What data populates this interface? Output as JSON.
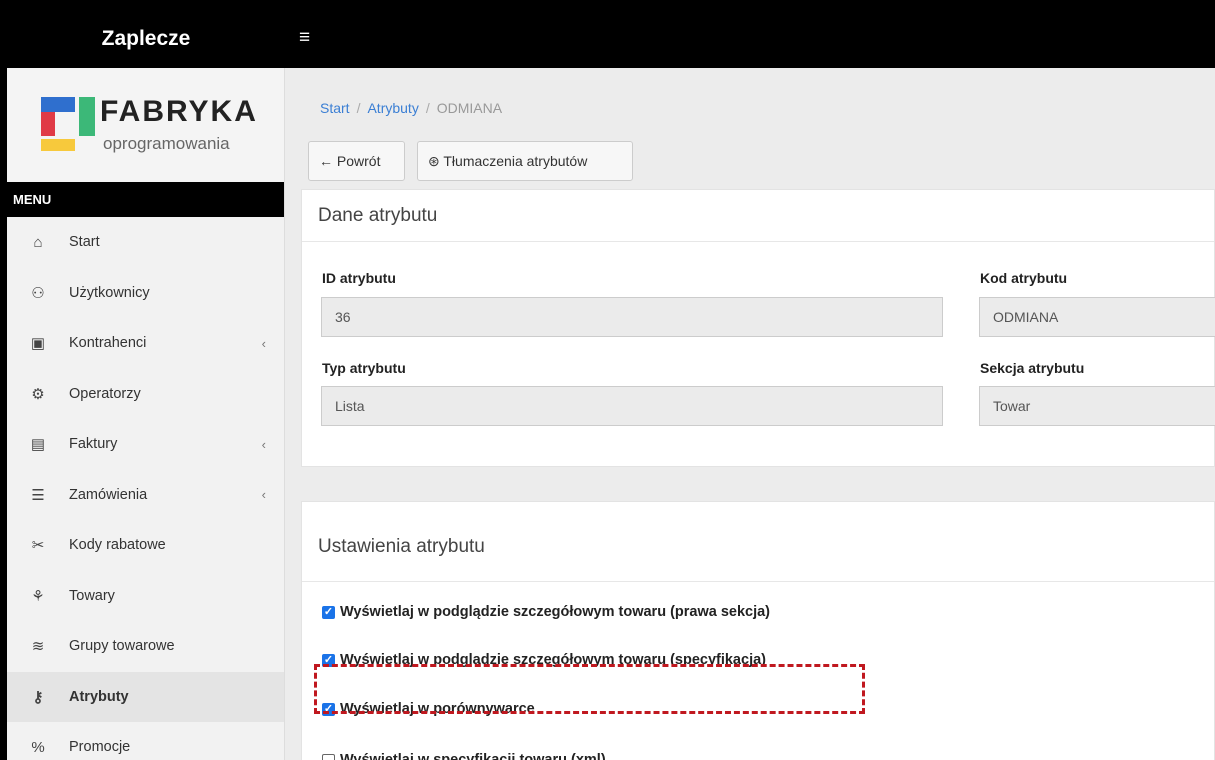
{
  "topbar": {
    "brand": "Zaplecze",
    "menu_toggle": "≡"
  },
  "logo": {
    "title": "FABRYKA",
    "subtitle": "oprogramowania"
  },
  "sidebar": {
    "heading": "MENU",
    "items": [
      {
        "label": "Start",
        "icon": "⌂",
        "chevron": ""
      },
      {
        "label": "Użytkownicy",
        "icon": "⚇",
        "chevron": ""
      },
      {
        "label": "Kontrahenci",
        "icon": "▣",
        "chevron": "‹"
      },
      {
        "label": "Operatorzy",
        "icon": "⚙",
        "chevron": ""
      },
      {
        "label": "Faktury",
        "icon": "▤",
        "chevron": "‹"
      },
      {
        "label": "Zamówienia",
        "icon": "☰",
        "chevron": "‹"
      },
      {
        "label": "Kody rabatowe",
        "icon": "✂",
        "chevron": ""
      },
      {
        "label": "Towary",
        "icon": "⚘",
        "chevron": ""
      },
      {
        "label": "Grupy towarowe",
        "icon": "≋",
        "chevron": ""
      },
      {
        "label": "Atrybuty",
        "icon": "⚷",
        "chevron": ""
      },
      {
        "label": "Promocje",
        "icon": "%",
        "chevron": ""
      }
    ]
  },
  "breadcrumb": {
    "start": "Start",
    "attributes": "Atrybuty",
    "current": "ODMIANA",
    "separator": "/"
  },
  "toolbar": {
    "back_label": "← Powrót",
    "translations_label": "⊛ Tłumaczenia atrybutów"
  },
  "attribute_data": {
    "title": "Dane atrybutu",
    "id_label": "ID atrybutu",
    "id_value": "36",
    "code_label": "Kod atrybutu",
    "code_value": "ODMIANA",
    "type_label": "Typ atrybutu",
    "type_value": "Lista",
    "section_label": "Sekcja atrybutu",
    "section_value": "Towar"
  },
  "attribute_settings": {
    "title": "Ustawienia atrybutu",
    "options": [
      {
        "label": "Wyświetlaj w podglądzie szczegółowym towaru (prawa sekcja)",
        "checked": true
      },
      {
        "label": "Wyświetlaj w podglądzie szczegółowym towaru (specyfikacja)",
        "checked": true
      },
      {
        "label": "Wyświetlaj w porównywarce",
        "checked": true
      },
      {
        "label": "Wyświetlaj w specyfikacji towaru (xml)",
        "checked": false
      }
    ]
  },
  "colors": {
    "accent": "#3b7fd4",
    "checkbox": "#1a73e8",
    "highlight": "#c0181f"
  }
}
